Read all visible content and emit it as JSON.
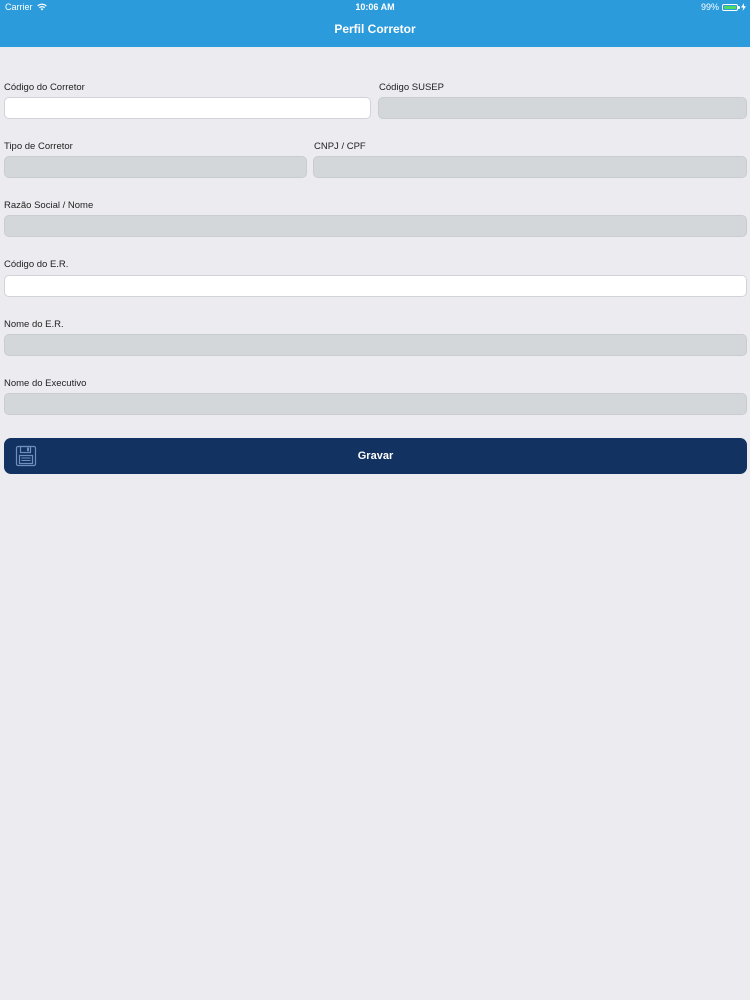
{
  "status_bar": {
    "carrier": "Carrier",
    "time": "10:06 AM",
    "battery": "99%",
    "battery_color": "#4cd964"
  },
  "header": {
    "title": "Perfil Corretor",
    "background": "#2b9bdb"
  },
  "form": {
    "codigo_corretor": {
      "label": "Código do Corretor",
      "value": "",
      "editable": true
    },
    "codigo_susep": {
      "label": "Código SUSEP",
      "value": "",
      "editable": false
    },
    "tipo_corretor": {
      "label": "Tipo de Corretor",
      "value": "",
      "editable": false
    },
    "cnpj_cpf": {
      "label": "CNPJ / CPF",
      "value": "",
      "editable": false
    },
    "razao_social": {
      "label": "Razão Social / Nome",
      "value": "",
      "editable": false
    },
    "codigo_er": {
      "label": "Código do E.R.",
      "value": "",
      "editable": true
    },
    "nome_er": {
      "label": "Nome do E.R.",
      "value": "",
      "editable": false
    },
    "nome_executivo": {
      "label": "Nome do Executivo",
      "value": "",
      "editable": false
    }
  },
  "save_button": {
    "label": "Gravar",
    "icon": "floppy-disk-icon",
    "background": "#123262"
  },
  "icons": {
    "wifi": "wifi-icon",
    "battery": "battery-icon"
  }
}
